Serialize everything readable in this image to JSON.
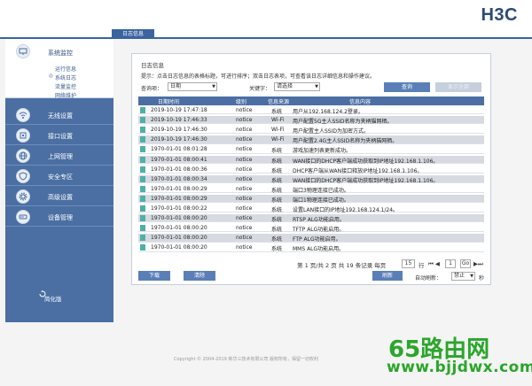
{
  "brand": {
    "logo": "H3C"
  },
  "tab": {
    "label": "日志信息"
  },
  "sidebar": {
    "items": [
      {
        "label": "系统监控",
        "icon": "monitor-icon"
      },
      {
        "label": "无线设置",
        "icon": "wireless-icon"
      },
      {
        "label": "接口设置",
        "icon": "interface-icon"
      },
      {
        "label": "上网管理",
        "icon": "internet-icon"
      },
      {
        "label": "安全专区",
        "icon": "shield-icon"
      },
      {
        "label": "高级设置",
        "icon": "gear-icon"
      },
      {
        "label": "设备管理",
        "icon": "device-icon"
      }
    ],
    "subitems": [
      "运行信息",
      "系统日志",
      "流量监控",
      "网络维护"
    ],
    "simple": "简化版"
  },
  "panel": {
    "title": "日志信息",
    "tip": "提示：点击日志信息的表格标题，可进行排序；双击日志表项，可查看该日志详细信息和操作建议。",
    "query_label": "查询项：",
    "query_value": "日期",
    "keyword_label": "关键字：",
    "keyword_value": "请选择",
    "search_btn": "查询",
    "show_all_btn": "显示全部"
  },
  "table": {
    "headers": [
      "日期时间",
      "级别",
      "信息来源",
      "信息内容"
    ],
    "rows": [
      [
        "2019-10-19 17:47:18",
        "notice",
        "系统",
        "用户从192.168.124.2登录。"
      ],
      [
        "2019-10-19 17:46:33",
        "notice",
        "Wi-Fi",
        "用户配置5G主人SSID名称为夹柄猫网栖。"
      ],
      [
        "2019-10-19 17:46:30",
        "notice",
        "Wi-Fi",
        "用户配置主人SSID为加密方式。"
      ],
      [
        "2019-10-19 17:46:30",
        "notice",
        "Wi-Fi",
        "用户配置2.4G主人SSID名称为夹柄猫网栖。"
      ],
      [
        "1970-01-01 08:01:28",
        "notice",
        "系统",
        "游戏加速列表更新成功。"
      ],
      [
        "1970-01-01 08:00:41",
        "notice",
        "系统",
        "WAN接口的DHCP客户端成功获取到IP地址192.168.1.106。"
      ],
      [
        "1970-01-01 08:00:36",
        "notice",
        "系统",
        "DHCP客户端从WAN接口释放IP地址192.168.1.106。"
      ],
      [
        "1970-01-01 08:00:34",
        "notice",
        "系统",
        "WAN接口的DHCP客户端成功获取到IP地址192.168.1.106。"
      ],
      [
        "1970-01-01 08:00:29",
        "notice",
        "系统",
        "端口3物理连接已成功。"
      ],
      [
        "1970-01-01 08:00:29",
        "notice",
        "系统",
        "端口1物理连接已成功。"
      ],
      [
        "1970-01-01 08:00:22",
        "notice",
        "系统",
        "设置LAN接口的IP地址192.168.124.1/24。"
      ],
      [
        "1970-01-01 08:00:20",
        "notice",
        "系统",
        "RTSP ALG功能启用。"
      ],
      [
        "1970-01-01 08:00:20",
        "notice",
        "系统",
        "TFTP ALG功能启用。"
      ],
      [
        "1970-01-01 08:00:20",
        "notice",
        "系统",
        "FTP ALG功能启用。"
      ],
      [
        "1970-01-01 08:00:20",
        "notice",
        "系统",
        "MMS ALG功能启用。"
      ]
    ]
  },
  "pager": {
    "summary": "第 1 页/共 2 页  共 19 条记录  每页",
    "per_page": "15",
    "unit_row": "行",
    "nav": "⏮ ◀",
    "page": "1",
    "go": "Go",
    "last": "▶⏭"
  },
  "bottom": {
    "download": "下载",
    "clear": "清除",
    "refresh": "刷新",
    "auto_label": "自动刷新：",
    "auto_value": "禁止",
    "unit": "秒"
  },
  "footer": {
    "copyright": "Copyright © 2004-2019  新华三技术有限公司  版权所有，保留一切权利"
  },
  "watermark": {
    "line1": "65路由网",
    "line2": "www.bjjdwx.com"
  }
}
